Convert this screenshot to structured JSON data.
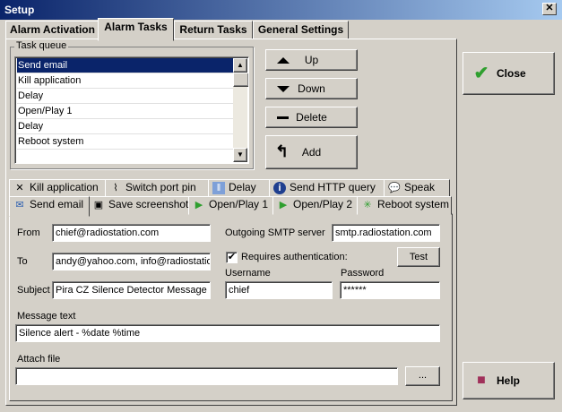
{
  "window": {
    "title": "Setup",
    "close_glyph": "✕"
  },
  "tabs": [
    "Alarm Activation",
    "Alarm Tasks",
    "Return Tasks",
    "General Settings"
  ],
  "task_queue": {
    "label": "Task queue",
    "items": [
      "Send email",
      "Kill application",
      "Delay",
      "Open/Play 1",
      "Delay",
      "Reboot system"
    ],
    "selected_index": 0
  },
  "queue_buttons": {
    "up": "Up",
    "down": "Down",
    "delete": "Delete",
    "add": "Add"
  },
  "sub_tabs_row1": [
    {
      "label": "Kill application",
      "icon": "close-x-icon"
    },
    {
      "label": "Switch port pin",
      "icon": "switch-icon"
    },
    {
      "label": "Delay",
      "icon": "pause-icon"
    },
    {
      "label": "Send HTTP query",
      "icon": "info-icon"
    },
    {
      "label": "Speak",
      "icon": "speech-bubble-icon"
    }
  ],
  "sub_tabs_row2": [
    {
      "label": "Send email",
      "icon": "envelope-icon"
    },
    {
      "label": "Save screenshot",
      "icon": "floppy-icon"
    },
    {
      "label": "Open/Play 1",
      "icon": "play-icon"
    },
    {
      "label": "Open/Play 2",
      "icon": "play-icon"
    },
    {
      "label": "Reboot system",
      "icon": "reboot-icon"
    }
  ],
  "email": {
    "from_label": "From",
    "from_value": "chief@radiostation.com",
    "to_label": "To",
    "to_value": "andy@yahoo.com, info@radiostatio",
    "subject_label": "Subject",
    "subject_value": "Pira CZ Silence Detector Message",
    "smtp_label": "Outgoing SMTP server",
    "smtp_value": "smtp.radiostation.com",
    "auth_label": "Requires authentication:",
    "auth_checked": true,
    "test_button": "Test",
    "username_label": "Username",
    "username_value": "chief",
    "password_label": "Password",
    "password_value": "******",
    "message_label": "Message text",
    "message_value": "Silence alert - %date %time",
    "attach_label": "Attach file",
    "attach_value": "",
    "browse_button": "..."
  },
  "side_buttons": {
    "close": "Close",
    "help": "Help"
  },
  "colors": {
    "title_bar": "#0a246a",
    "selection": "#0a246a",
    "face": "#d4d0c8"
  }
}
